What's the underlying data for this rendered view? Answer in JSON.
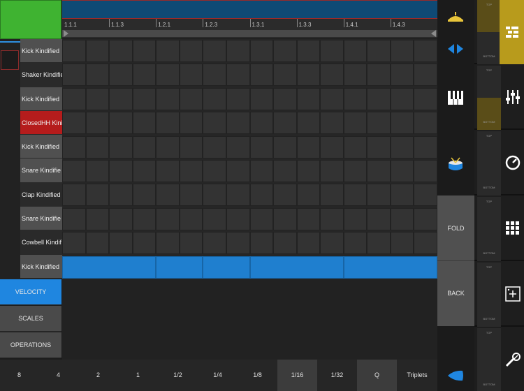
{
  "ruler": {
    "labels": [
      "1.1.1",
      "1.1.3",
      "1.2.1",
      "1.2.3",
      "1.3.1",
      "1.3.3",
      "1.4.1",
      "1.4.3"
    ]
  },
  "tracks": [
    {
      "name": "Kick Kindified",
      "style": "normal"
    },
    {
      "name": "Shaker Kindifie",
      "style": "alt"
    },
    {
      "name": "Kick Kindified",
      "style": "normal"
    },
    {
      "name": "ClosedHH Kini",
      "style": "red"
    },
    {
      "name": "Kick Kindified",
      "style": "normal"
    },
    {
      "name": "Snare Kindifie",
      "style": "normal"
    },
    {
      "name": "Clap Kindified",
      "style": "alt"
    },
    {
      "name": "Snare Kindifie",
      "style": "normal"
    },
    {
      "name": "Cowbell Kindif",
      "style": "alt"
    },
    {
      "name": "Kick Kindified",
      "style": "normal"
    }
  ],
  "grid": {
    "rows": 10,
    "columns": 16,
    "active_row": 9
  },
  "side_buttons": {
    "velocity": "VELOCITY",
    "scales": "SCALES",
    "operations": "OPERATIONS"
  },
  "quantize": {
    "buttons": [
      "8",
      "4",
      "2",
      "1",
      "1/2",
      "1/4",
      "1/8",
      "1/16",
      "1/32",
      "Q",
      "Triplets"
    ],
    "active": [
      "1/16",
      "Q"
    ]
  },
  "tools": {
    "fold": "FOLD",
    "back": "BACK",
    "icons": [
      "hat-icon",
      "arrows-left-right-icon",
      "piano-icon",
      "drum-icon",
      "drop-icon"
    ]
  },
  "panel": {
    "top_label": "TOP",
    "bottom_label": "BOTTOM",
    "icons": [
      "list-icon",
      "mixer-icon",
      "dial-icon",
      "pad-grid-icon",
      "add-box-icon",
      "pencil-tool-icon"
    ]
  },
  "colors": {
    "accent_blue": "#1f86e0",
    "clip_green": "#3fb331",
    "track_red": "#b51c1c",
    "gold": "#b89b1c",
    "note_blue": "#1f7fcf"
  }
}
